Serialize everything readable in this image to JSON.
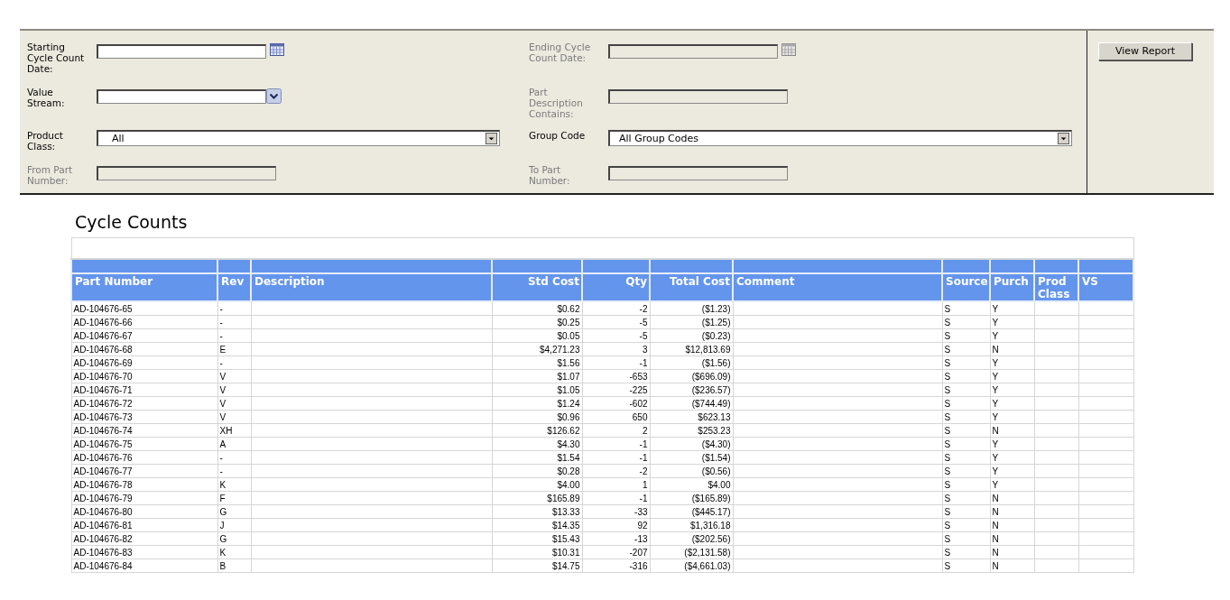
{
  "filters": [
    {
      "label": "Starting Cycle Count Date:",
      "kind": "date",
      "disabled": false
    },
    {
      "label": "Ending Cycle Count Date:",
      "kind": "date",
      "disabled": true
    },
    {
      "label": "Value Stream:",
      "kind": "dropdown",
      "disabled": false
    },
    {
      "label": "Part Description Contains:",
      "kind": "text",
      "disabled": true
    },
    {
      "label": "Product Class:",
      "kind": "combo",
      "disabled": false,
      "value": "All"
    },
    {
      "label": "Group Code",
      "kind": "combo",
      "disabled": false,
      "value": "All Group Codes"
    },
    {
      "label": "From Part Number:",
      "kind": "text",
      "disabled": true
    },
    {
      "label": "To Part Number:",
      "kind": "text",
      "disabled": true
    }
  ],
  "view_button": "View Report",
  "report": {
    "title": "Cycle Counts",
    "columns": [
      {
        "label": "Part Number",
        "kind": "text"
      },
      {
        "label": "Rev",
        "kind": "text"
      },
      {
        "label": "Description",
        "kind": "blank"
      },
      {
        "label": "Std Cost",
        "kind": "numeric"
      },
      {
        "label": "Qty",
        "kind": "numeric"
      },
      {
        "label": "Total Cost",
        "kind": "numeric"
      },
      {
        "label": "Comment",
        "kind": "blank"
      },
      {
        "label": "Source",
        "kind": "text"
      },
      {
        "label": "Purch",
        "kind": "text"
      },
      {
        "label": "Prod Class",
        "kind": "blank"
      },
      {
        "label": "VS",
        "kind": "blank"
      }
    ],
    "rows": [
      {
        "part": "AD-104676-65",
        "rev": "-",
        "std_cost": "$0.62",
        "qty": "-2",
        "total_cost": "($1.23)",
        "source": "S",
        "purch": "Y"
      },
      {
        "part": "AD-104676-66",
        "rev": "-",
        "std_cost": "$0.25",
        "qty": "-5",
        "total_cost": "($1.25)",
        "source": "S",
        "purch": "Y"
      },
      {
        "part": "AD-104676-67",
        "rev": "-",
        "std_cost": "$0.05",
        "qty": "-5",
        "total_cost": "($0.23)",
        "source": "S",
        "purch": "Y"
      },
      {
        "part": "AD-104676-68",
        "rev": "E",
        "std_cost": "$4,271.23",
        "qty": "3",
        "total_cost": "$12,813.69",
        "source": "S",
        "purch": "N"
      },
      {
        "part": "AD-104676-69",
        "rev": "-",
        "std_cost": "$1.56",
        "qty": "-1",
        "total_cost": "($1.56)",
        "source": "S",
        "purch": "Y"
      },
      {
        "part": "AD-104676-70",
        "rev": "V",
        "std_cost": "$1.07",
        "qty": "-653",
        "total_cost": "($696.09)",
        "source": "S",
        "purch": "Y"
      },
      {
        "part": "AD-104676-71",
        "rev": "V",
        "std_cost": "$1.05",
        "qty": "-225",
        "total_cost": "($236.57)",
        "source": "S",
        "purch": "Y"
      },
      {
        "part": "AD-104676-72",
        "rev": "V",
        "std_cost": "$1.24",
        "qty": "-602",
        "total_cost": "($744.49)",
        "source": "S",
        "purch": "Y"
      },
      {
        "part": "AD-104676-73",
        "rev": "V",
        "std_cost": "$0.96",
        "qty": "650",
        "total_cost": "$623.13",
        "source": "S",
        "purch": "Y"
      },
      {
        "part": "AD-104676-74",
        "rev": "XH",
        "std_cost": "$126.62",
        "qty": "2",
        "total_cost": "$253.23",
        "source": "S",
        "purch": "N"
      },
      {
        "part": "AD-104676-75",
        "rev": "A",
        "std_cost": "$4.30",
        "qty": "-1",
        "total_cost": "($4.30)",
        "source": "S",
        "purch": "Y"
      },
      {
        "part": "AD-104676-76",
        "rev": "-",
        "std_cost": "$1.54",
        "qty": "-1",
        "total_cost": "($1.54)",
        "source": "S",
        "purch": "Y"
      },
      {
        "part": "AD-104676-77",
        "rev": "-",
        "std_cost": "$0.28",
        "qty": "-2",
        "total_cost": "($0.56)",
        "source": "S",
        "purch": "Y"
      },
      {
        "part": "AD-104676-78",
        "rev": "K",
        "std_cost": "$4.00",
        "qty": "1",
        "total_cost": "$4.00",
        "source": "S",
        "purch": "Y"
      },
      {
        "part": "AD-104676-79",
        "rev": "F",
        "std_cost": "$165.89",
        "qty": "-1",
        "total_cost": "($165.89)",
        "source": "S",
        "purch": "N"
      },
      {
        "part": "AD-104676-80",
        "rev": "G",
        "std_cost": "$13.33",
        "qty": "-33",
        "total_cost": "($445.17)",
        "source": "S",
        "purch": "N"
      },
      {
        "part": "AD-104676-81",
        "rev": "J",
        "std_cost": "$14.35",
        "qty": "92",
        "total_cost": "$1,316.18",
        "source": "S",
        "purch": "N"
      },
      {
        "part": "AD-104676-82",
        "rev": "G",
        "std_cost": "$15.43",
        "qty": "-13",
        "total_cost": "($202.56)",
        "source": "S",
        "purch": "N"
      },
      {
        "part": "AD-104676-83",
        "rev": "K",
        "std_cost": "$10.31",
        "qty": "-207",
        "total_cost": "($2,131.58)",
        "source": "S",
        "purch": "N"
      },
      {
        "part": "AD-104676-84",
        "rev": "B",
        "std_cost": "$14.75",
        "qty": "-316",
        "total_cost": "($4,661.03)",
        "source": "S",
        "purch": "N"
      }
    ]
  }
}
